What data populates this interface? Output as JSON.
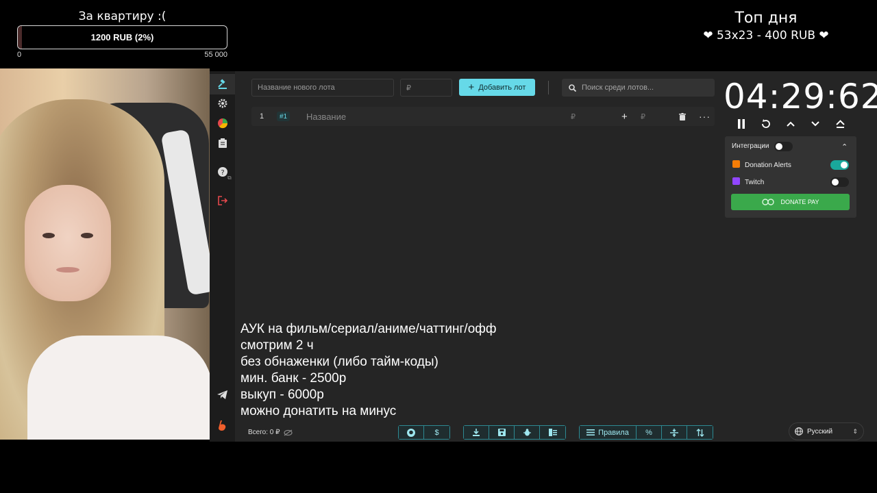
{
  "overlay": {
    "goal": {
      "title": "За квартиру :(",
      "bar_text": "1200 RUB (2%)",
      "min": "0",
      "max": "55 000",
      "progress_pct": 2
    },
    "top_day": {
      "title": "Топ дня",
      "line": "❤ 53x23 - 400 RUB ❤"
    }
  },
  "toolbar": {
    "new_lot_placeholder": "Название нового лота",
    "rub_placeholder": "₽",
    "add_lot_label": "Добавить лот",
    "search_placeholder": "Поиск среди лотов..."
  },
  "lot": {
    "number": "1",
    "badge": "#1",
    "name_placeholder": "Название",
    "rub": "₽",
    "plus": "+",
    "rub2": "₽",
    "more": "···"
  },
  "timer": {
    "value": "04:29:62"
  },
  "integrations": {
    "title": "Интеграции",
    "items": [
      {
        "label": "Donation Alerts",
        "enabled": true,
        "color": "#f57d07"
      },
      {
        "label": "Twitch",
        "enabled": false,
        "color": "#9146ff"
      }
    ],
    "donatepay_label": "DONATE PAY"
  },
  "rules": [
    "АУК на фильм/сериал/аниме/чаттинг/офф",
    "смотрим 2 ч",
    "без обнаженки (либо тайм-коды)",
    "мин. банк - 2500р",
    "выкуп - 6000р",
    "можно донатить на минус"
  ],
  "footer": {
    "total": "Всего: 0 ₽",
    "rules_label": "Правила",
    "percent": "%",
    "language": "Русский"
  },
  "colors": {
    "accent": "#66d9e8",
    "bg": "#252525",
    "sidebar": "#1c1c1c",
    "donatepay": "#3aa94b",
    "danger": "#e5484d"
  },
  "icons": {
    "nav": [
      "gavel-icon",
      "gear-icon",
      "pie-chart-icon",
      "clipboard-icon",
      "help-icon",
      "logout-icon",
      "telegram-icon",
      "boosty-icon"
    ],
    "timer": [
      "pause-icon",
      "reset-icon",
      "chevron-up-icon",
      "chevron-down-icon",
      "eject-icon"
    ]
  }
}
